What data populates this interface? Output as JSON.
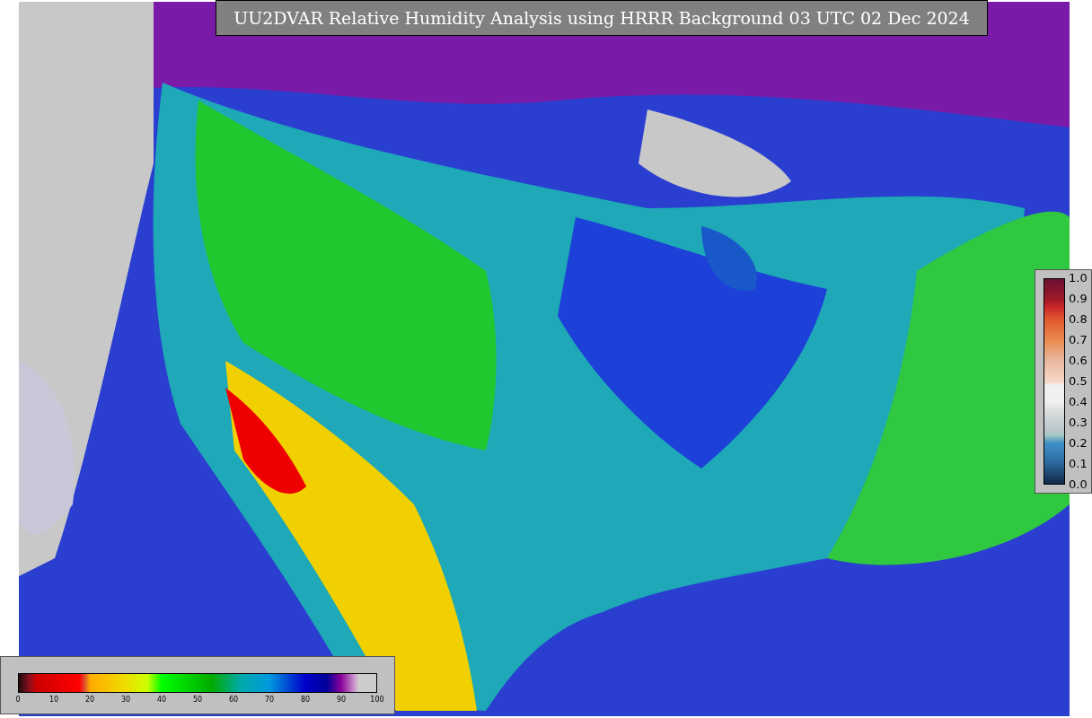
{
  "title": "UU2DVAR Relative Humidity Analysis using HRRR Background 03 UTC 02 Dec 2024",
  "humidity_colorbar": {
    "ticks": [
      "0",
      "10",
      "20",
      "30",
      "40",
      "50",
      "60",
      "70",
      "80",
      "90",
      "100"
    ]
  },
  "observation_colorbar": {
    "ticks": [
      "1.0",
      "0.9",
      "0.8",
      "0.7",
      "0.6",
      "0.5",
      "0.4",
      "0.3",
      "0.2",
      "0.1",
      "0.0"
    ]
  }
}
